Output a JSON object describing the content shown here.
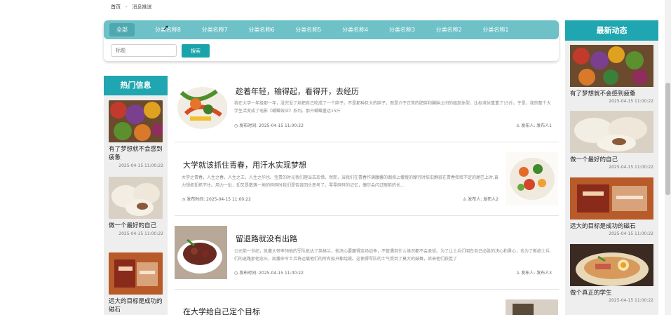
{
  "breadcrumb": {
    "home": "首页",
    "sep": "-",
    "current": "消息推送"
  },
  "tabs": [
    "全部",
    "分类名称8",
    "分类名称7",
    "分类名称6",
    "分类名称5",
    "分类名称4",
    "分类名称3",
    "分类名称2",
    "分类名称1"
  ],
  "search": {
    "placeholder": "标题",
    "button": "搜索"
  },
  "hot": {
    "title": "热门信息",
    "items": [
      {
        "title": "有了梦想就不会感到疲惫",
        "time": "2025-04-15 11:00:22"
      },
      {
        "title": "做一个最好的自己",
        "time": "2025-04-15 11:00:22"
      },
      {
        "title": "远大的目标是成功的磁石",
        "time": ""
      }
    ]
  },
  "latest": {
    "title": "最新动态",
    "items": [
      {
        "title": "有了梦想就不会感到疲惫",
        "time": "2025-04-15 11:00:22"
      },
      {
        "title": "做一个最好的自己",
        "time": "2025-04-15 11:00:22"
      },
      {
        "title": "远大的目标是成功的磁石",
        "time": "2025-04-15 11:00:22"
      },
      {
        "title": "做个真正的学生",
        "time": "2025-04-15 11:00:22"
      }
    ]
  },
  "articles": [
    {
      "title": "趁着年轻，输得起，看得开，去经历",
      "excerpt": "我在大学一年级那一年，没完没了地把自己吃成了一个胖子。不是那种巨大的胖子，而是介于正常的肥胖和臃肿之间的尴尬体型，比标准体重重了15斤。于是，我的整个大学生活变成了电影《蝴蝶效应》系列。那只蝴蝶重达15斤",
      "time_label": "发布时间: 2025-04-15 11:00:22",
      "author_label": "发布人: 发布人1"
    },
    {
      "title": "大学就该抓住青春，用汗水实现梦想",
      "excerpt": "大学之青春，人生之春，人生之王，人生之华也。宝贵的时光我们理当去珍惜。然而，当我们在青春作满腹馨的图境上撒慢的摩行时依旧静寂在青春挥挥不定的尾巴上时,奋力想抓却抓不住。用力一扯，却又是散落一地的碎碎时我们是否该回头思考了。零零碎碎的记忆，偶尔会闪过眼前的长...",
      "time_label": "发布时间: 2025-04-15 11:00:22",
      "author_label": "发布人: 发布人2"
    },
    {
      "title": "留退路就没有出路",
      "excerpt": "公元前一世纪，凯撒大帝率领他的军队抵达了英格兰，他决心要赢得这场战争，不管遇到什么境况都不会退却。为了让士兵们明白自己必胜的决心和勇心，也为了断绝士兵们的退路那他念头，凯撒命令士兵将运载他们的所有船只都烧毁。这使得军队的士气受到了莫大的鼓舞，后来他们获胜了",
      "time_label": "发布时间: 2025-04-15 11:00:22",
      "author_label": "发布人: 发布人3"
    },
    {
      "title": "在大学给自己定个目标",
      "excerpt": "",
      "time_label": "",
      "author_label": ""
    }
  ],
  "colors": {
    "teal": "#1fa6b0",
    "tab_bar": "#6dc1c7",
    "tab_active": "#4fa8b0",
    "side_bg": "#eeeeee",
    "search_button": "#19a3aa"
  },
  "icons": {
    "clock": "clock-icon",
    "user": "user-icon"
  }
}
